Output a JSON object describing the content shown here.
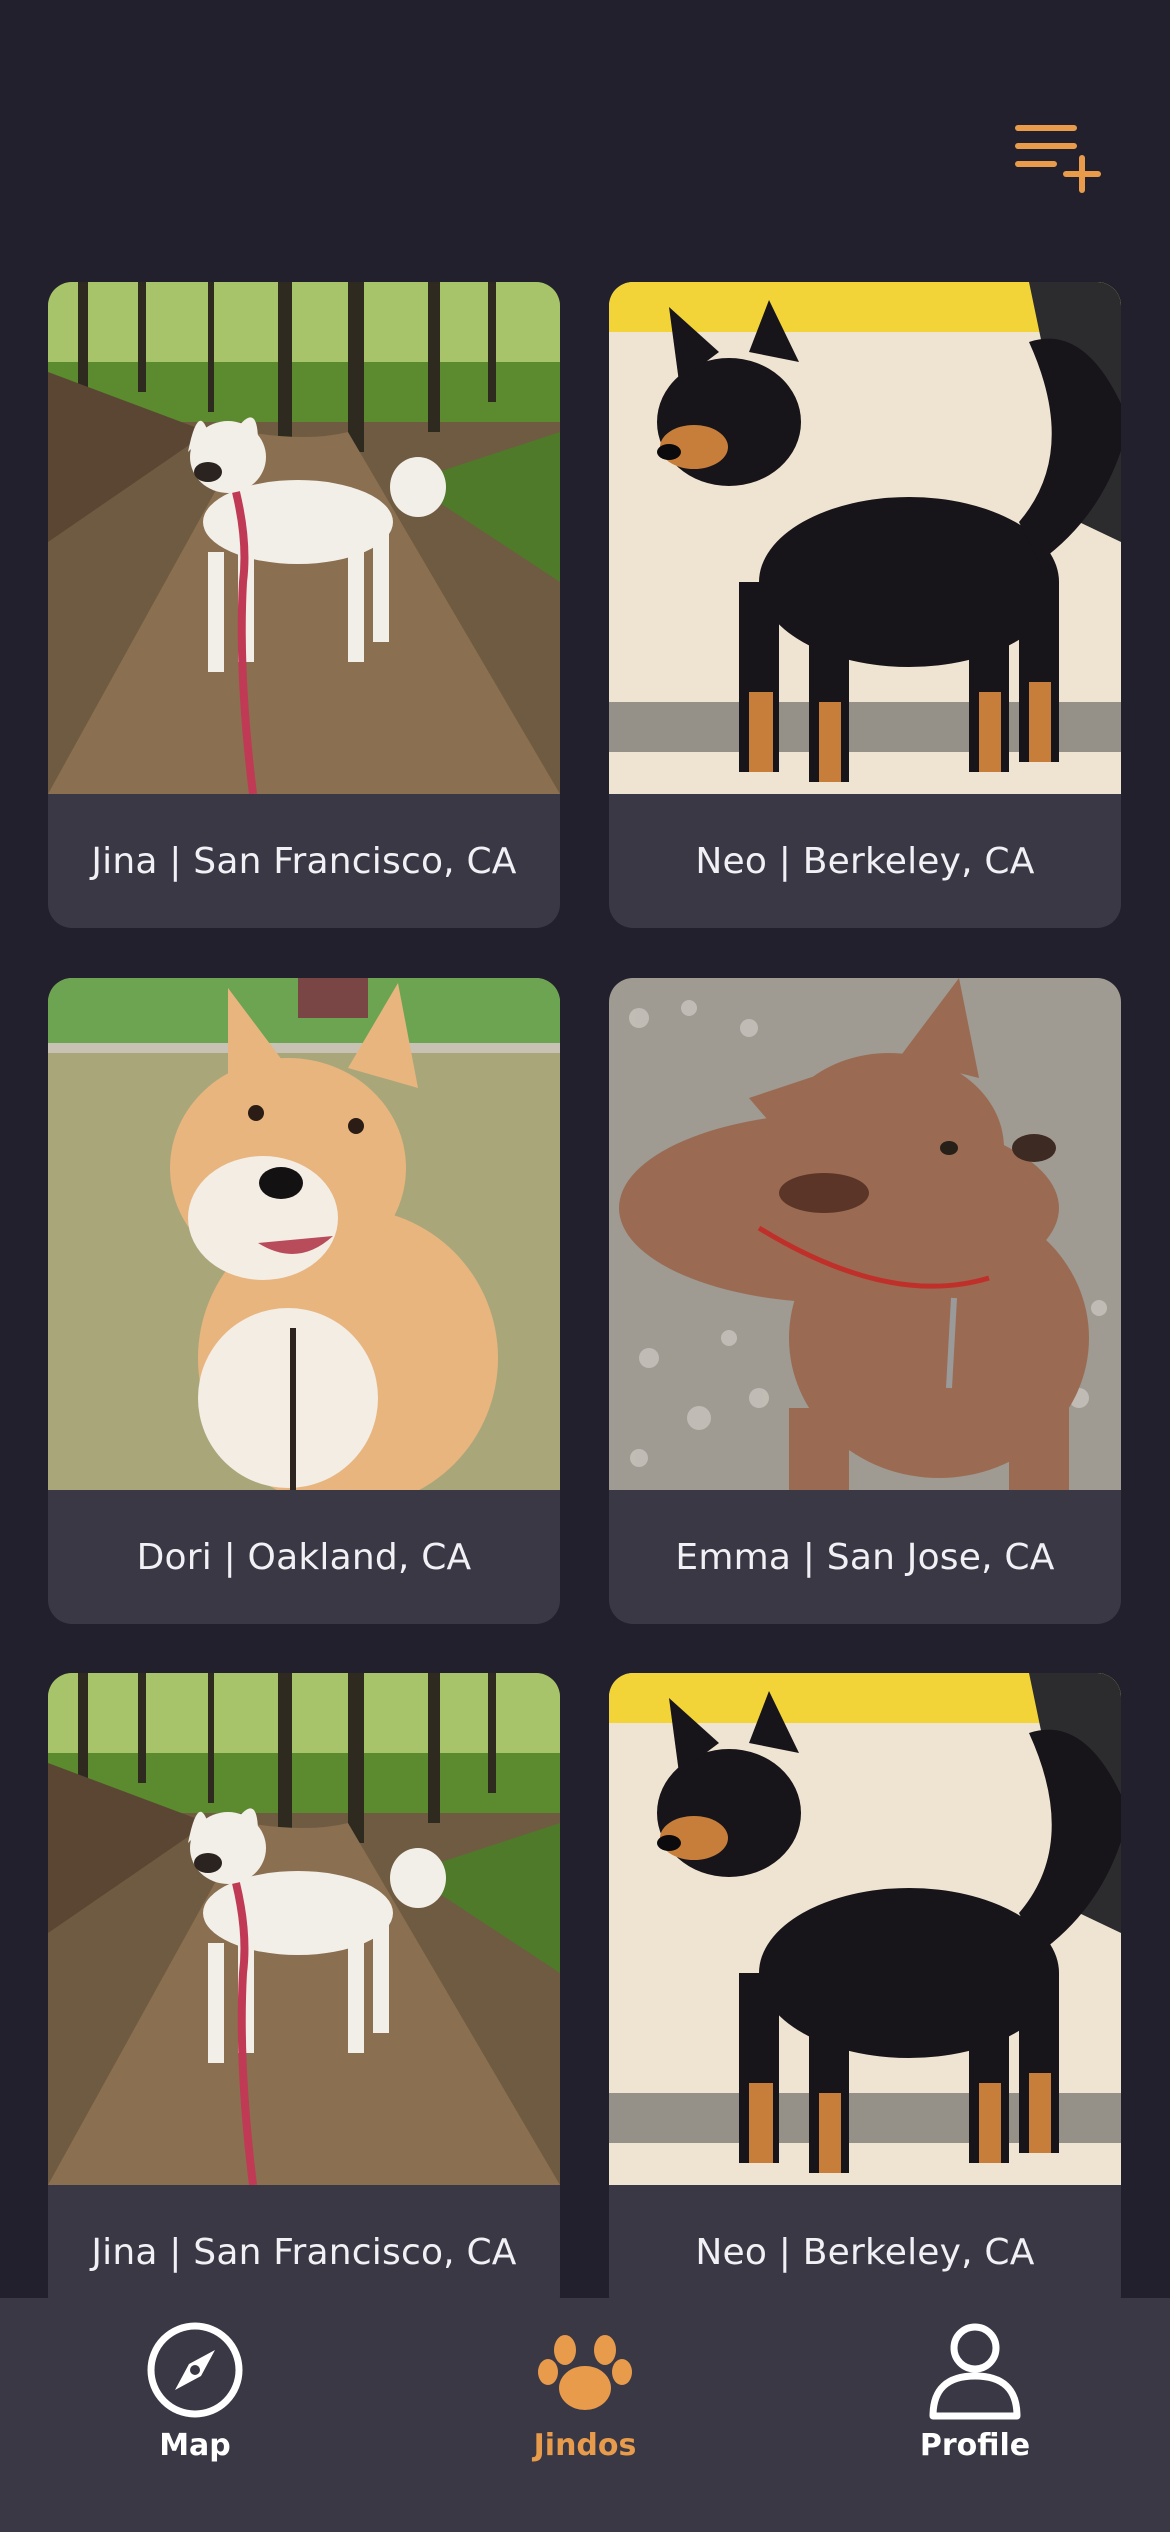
{
  "colors": {
    "background": "#22202c",
    "card": "#3a3845",
    "accent": "#e89b4b",
    "text": "#f1f0f4"
  },
  "header": {
    "action_icon": "add-to-list-icon"
  },
  "cards": [
    {
      "label": "Jina | San Francisco, CA",
      "photo": "white-dog-on-forest-trail"
    },
    {
      "label": "Neo | Berkeley, CA",
      "photo": "black-and-tan-dog-standing"
    },
    {
      "label": "Dori | Oakland, CA",
      "photo": "red-dog-on-grass"
    },
    {
      "label": "Emma | San Jose, CA",
      "photo": "brown-dog-lying-on-gravel"
    },
    {
      "label": "Jina | San Francisco, CA",
      "photo": "white-dog-on-forest-trail"
    },
    {
      "label": "Neo | Berkeley, CA",
      "photo": "black-and-tan-dog-standing"
    }
  ],
  "tabbar": {
    "tabs": [
      {
        "label": "Map",
        "icon": "compass-icon",
        "active": false
      },
      {
        "label": "Jindos",
        "icon": "paw-icon",
        "active": true
      },
      {
        "label": "Profile",
        "icon": "person-icon",
        "active": false
      }
    ]
  }
}
